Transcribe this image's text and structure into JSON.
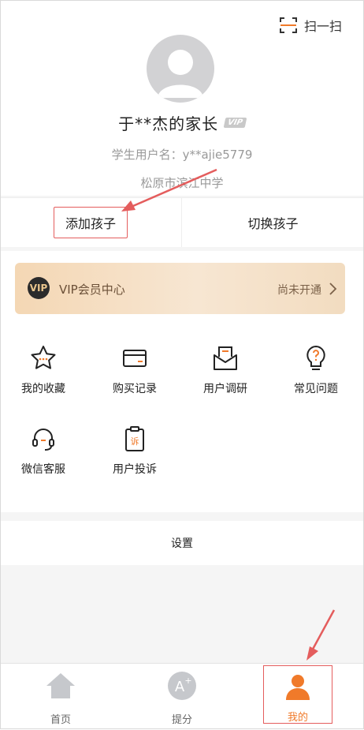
{
  "header": {
    "scan_label": "扫一扫",
    "parent_name": "于**杰的家长",
    "vip_badge": "VIP",
    "username": "学生用户名：y**ajie5779",
    "school": "松原市滨江中学"
  },
  "child_actions": {
    "add": "添加孩子",
    "switch": "切换孩子"
  },
  "vip_card": {
    "icon_text": "VIP",
    "title": "VIP会员中心",
    "status": "尚未开通"
  },
  "features": [
    {
      "label": "我的收藏",
      "icon": "star-icon"
    },
    {
      "label": "购买记录",
      "icon": "card-icon"
    },
    {
      "label": "用户调研",
      "icon": "mail-icon"
    },
    {
      "label": "常见问题",
      "icon": "bulb-question-icon"
    },
    {
      "label": "微信客服",
      "icon": "headset-icon"
    },
    {
      "label": "用户投诉",
      "icon": "clipboard-complaint-icon"
    }
  ],
  "settings_label": "设置",
  "nav": [
    {
      "label": "首页",
      "icon": "home-icon"
    },
    {
      "label": "提分",
      "icon": "grade-a-plus-icon"
    },
    {
      "label": "我的",
      "icon": "person-icon"
    }
  ],
  "colors": {
    "accent_orange": "#f07a2a",
    "annotation_red": "#e45d5d",
    "vip_gold": "#e8c48c"
  }
}
